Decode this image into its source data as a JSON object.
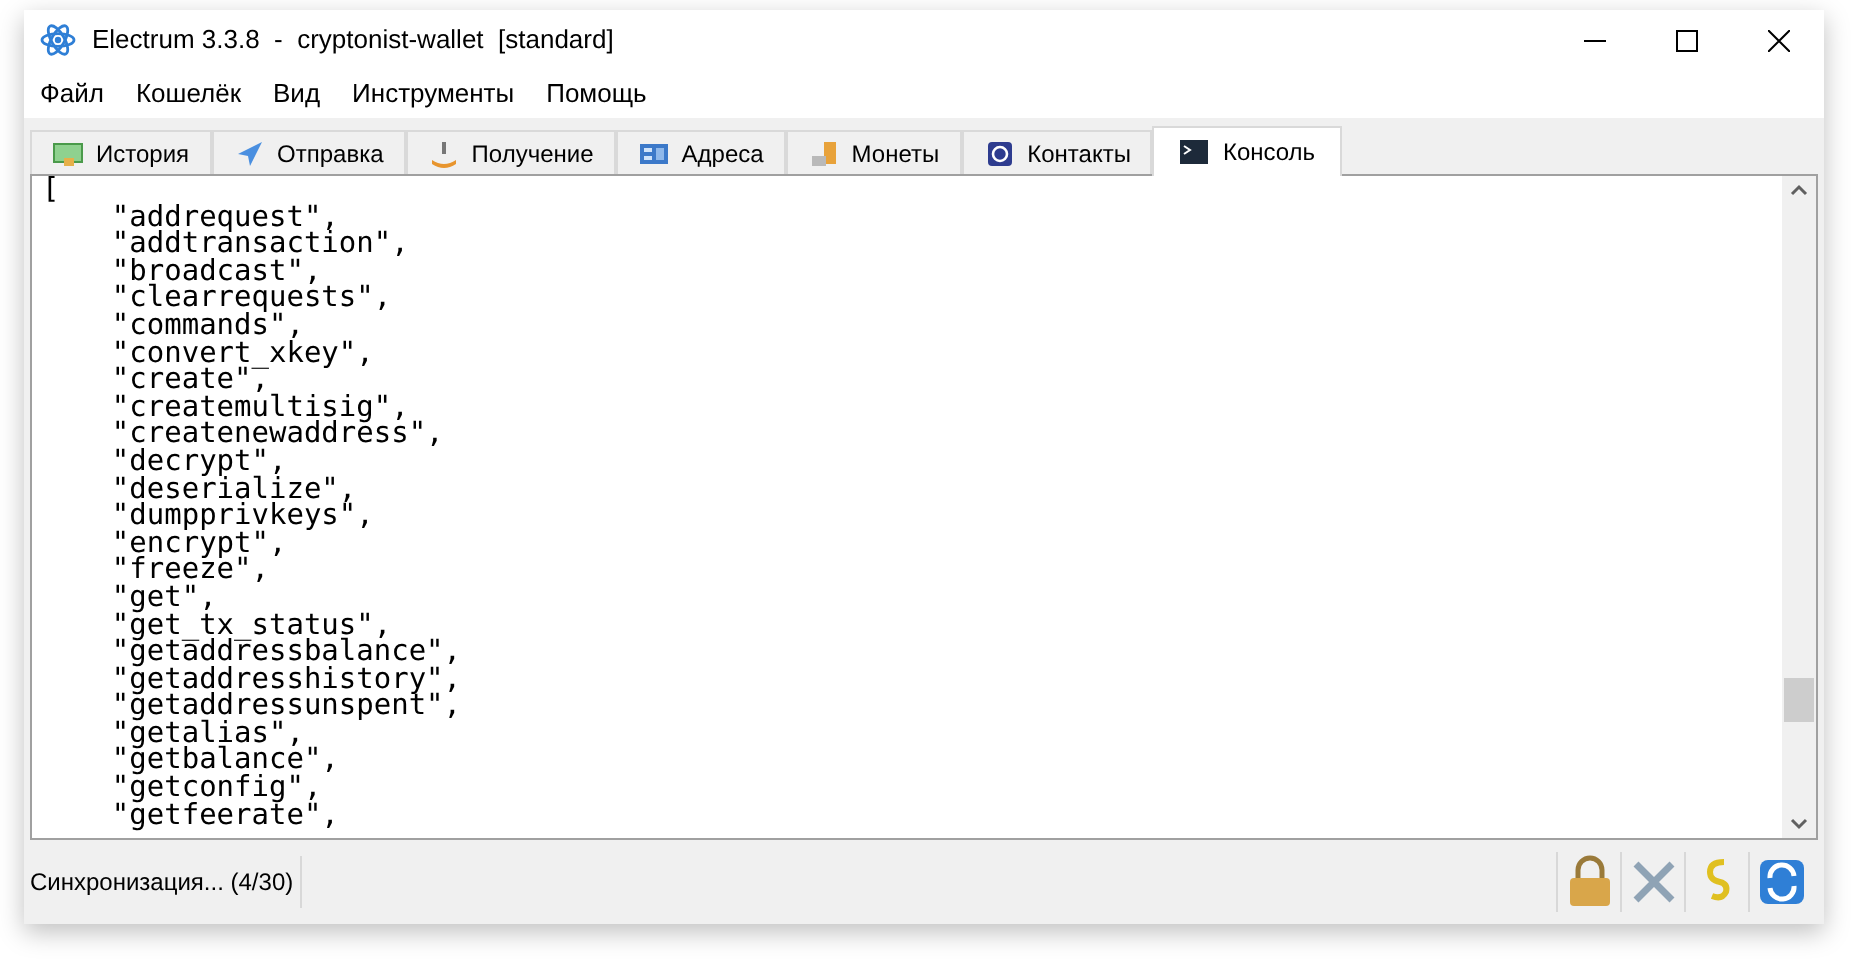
{
  "window": {
    "title": "Electrum 3.3.8  -  cryptonist-wallet  [standard]"
  },
  "menu": [
    "Файл",
    "Кошелёк",
    "Вид",
    "Инструменты",
    "Помощь"
  ],
  "tabs": [
    {
      "label": "История",
      "selected": false
    },
    {
      "label": "Отправка",
      "selected": false
    },
    {
      "label": "Получение",
      "selected": false
    },
    {
      "label": "Адреса",
      "selected": false
    },
    {
      "label": "Монеты",
      "selected": false
    },
    {
      "label": "Контакты",
      "selected": false
    },
    {
      "label": "Консоль",
      "selected": true
    }
  ],
  "console": {
    "lines": [
      "[",
      "    \"addrequest\",",
      "    \"addtransaction\",",
      "    \"broadcast\",",
      "    \"clearrequests\",",
      "    \"commands\",",
      "    \"convert_xkey\",",
      "    \"create\",",
      "    \"createmultisig\",",
      "    \"createnewaddress\",",
      "    \"decrypt\",",
      "    \"deserialize\",",
      "    \"dumpprivkeys\",",
      "    \"encrypt\",",
      "    \"freeze\",",
      "    \"get\",",
      "    \"get_tx_status\",",
      "    \"getaddressbalance\",",
      "    \"getaddresshistory\",",
      "    \"getaddressunspent\",",
      "    \"getalias\",",
      "    \"getbalance\",",
      "    \"getconfig\",",
      "    \"getfeerate\","
    ]
  },
  "status_bar": {
    "text": "Синхронизация... (4/30)"
  }
}
